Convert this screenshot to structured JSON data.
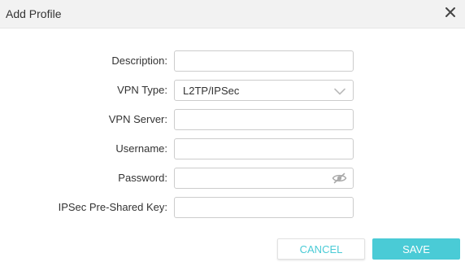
{
  "dialog": {
    "title": "Add Profile"
  },
  "form": {
    "description": {
      "label": "Description:",
      "value": ""
    },
    "vpn_type": {
      "label": "VPN Type:",
      "value": "L2TP/IPSec"
    },
    "vpn_server": {
      "label": "VPN Server:",
      "value": ""
    },
    "username": {
      "label": "Username:",
      "value": ""
    },
    "password": {
      "label": "Password:",
      "value": ""
    },
    "psk": {
      "label": "IPSec Pre-Shared Key:",
      "value": ""
    }
  },
  "buttons": {
    "cancel": "CANCEL",
    "save": "SAVE"
  },
  "icons": {
    "close": "close-icon",
    "dropdown": "chevron-down-icon",
    "password_toggle": "eye-slash-icon"
  },
  "colors": {
    "accent": "#4acbd6",
    "header_bg": "#f2f2f2",
    "border": "#cccccc"
  }
}
